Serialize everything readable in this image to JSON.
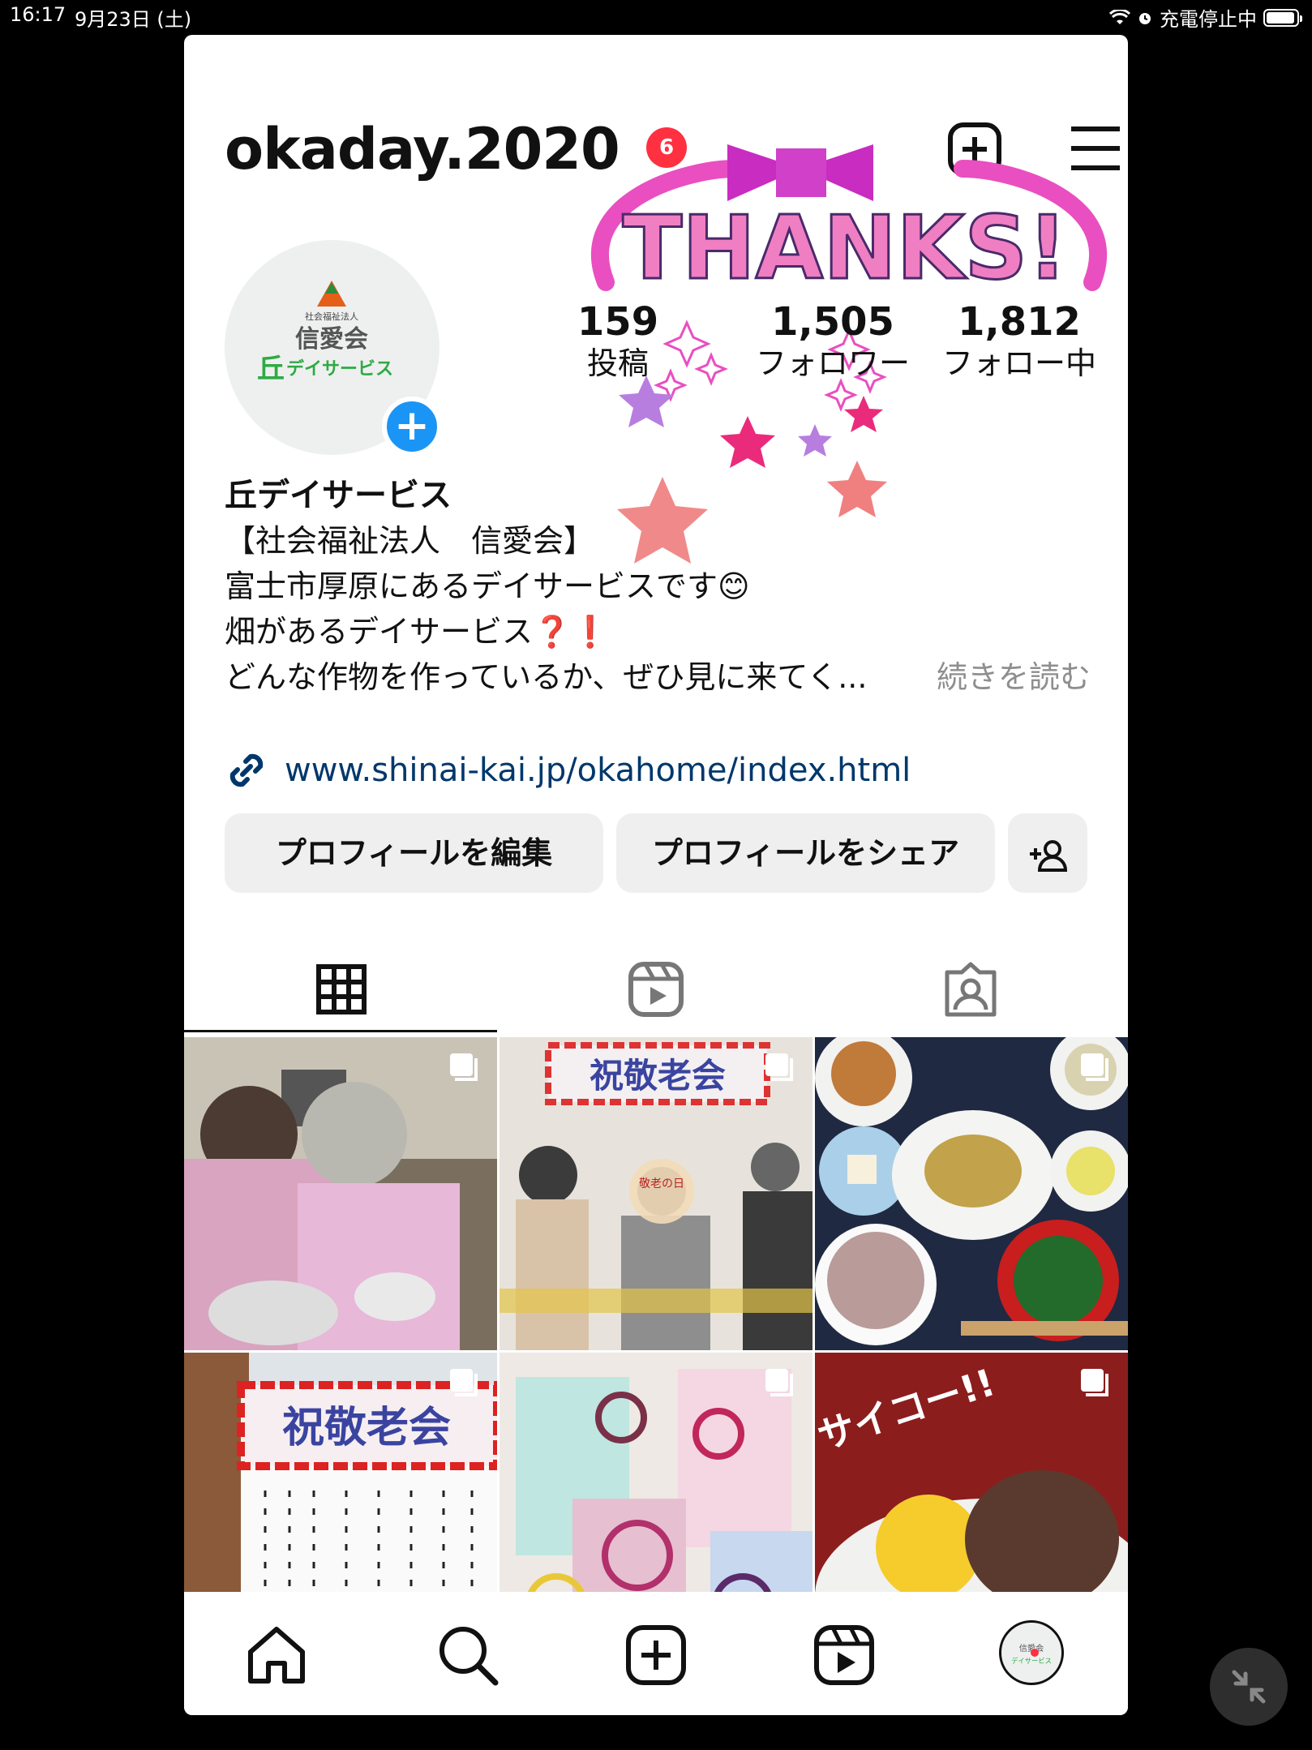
{
  "status_bar": {
    "time": "16:17",
    "date": "9月23日 (土)",
    "charging": "充電停止中",
    "battery_level": 0.95
  },
  "profile": {
    "username": "okaday.2020",
    "notification_count": "6",
    "display_name": "丘デイサービス",
    "bio_lines": [
      "【社会福祉法人　信愛会】",
      "富士市厚原にあるデイサービスです😊",
      "畑があるデイサービス❓❗",
      "どんな作物を作っているか、ぜひ見に来てく..."
    ],
    "more_label": "続きを読む",
    "link": "www.shinai-kai.jp/okahome/index.html",
    "avatar_text": {
      "org": "社会福祉法人",
      "group": "信愛会",
      "service": "デイサービス",
      "kanji": "丘"
    }
  },
  "stats": [
    {
      "value": "159",
      "label": "投稿"
    },
    {
      "value": "1,505",
      "label": "フォロワー"
    },
    {
      "value": "1,812",
      "label": "フォロー中"
    }
  ],
  "overlay": {
    "thanks": "THANKS!"
  },
  "buttons": {
    "edit": "プロフィールを編集",
    "share": "プロフィールをシェア",
    "add_person_icon": "add-person-icon"
  },
  "tabs": [
    {
      "name": "grid-icon",
      "active": true
    },
    {
      "name": "reels-icon",
      "active": false
    },
    {
      "name": "tagged-icon",
      "active": false
    }
  ],
  "posts": [
    {
      "subject": "cooking",
      "kind": "carousel"
    },
    {
      "subject": "keirokai-group",
      "kind": "carousel",
      "banner": "祝敬老会",
      "fan": "敬老の日"
    },
    {
      "subject": "meal",
      "kind": "carousel"
    },
    {
      "subject": "keirokai-program",
      "kind": "carousel",
      "banner": "祝敬老会"
    },
    {
      "subject": "crafts",
      "kind": "carousel"
    },
    {
      "subject": "sweets",
      "kind": "carousel",
      "caption": "サイコー!!"
    }
  ],
  "bottom_nav": [
    "home-icon",
    "search-icon",
    "create-icon",
    "reels-icon",
    "profile-avatar"
  ],
  "colors": {
    "link": "#00376b",
    "badge": "#ff3040",
    "accent": "#1b95f5",
    "thanks_pink": "#e94fc0"
  }
}
